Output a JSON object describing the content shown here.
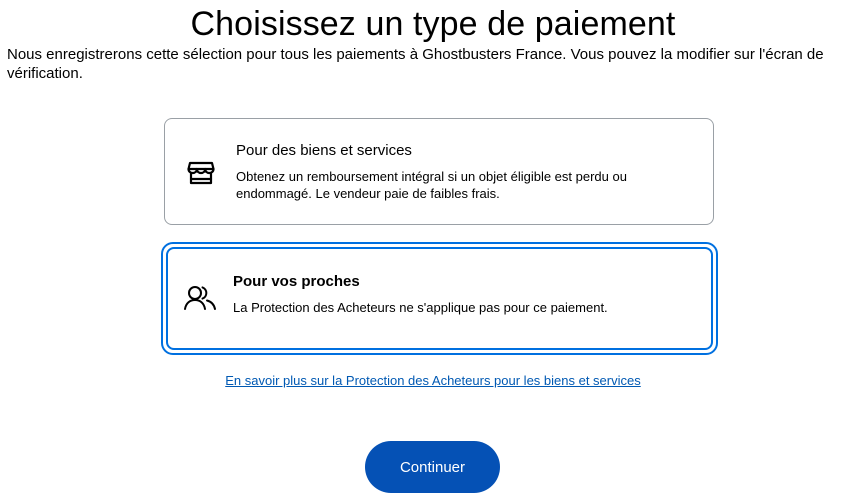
{
  "header": {
    "title": "Choisissez un type de paiement",
    "subtitle": "Nous enregistrerons cette sélection pour tous les paiements à Ghostbusters France. Vous pouvez la modifier sur l'écran de vérification."
  },
  "options": [
    {
      "title": "Pour des biens et services",
      "description": "Obtenez un remboursement intégral si un objet éligible est perdu ou endommagé. Le vendeur paie de faibles frais.",
      "icon": "storefront-icon",
      "selected": false
    },
    {
      "title": "Pour vos proches",
      "description": "La Protection des Acheteurs ne s'applique pas pour ce paiement.",
      "icon": "people-icon",
      "selected": true
    }
  ],
  "links": {
    "learn_more": "En savoir plus sur la Protection des Acheteurs pour les biens et services"
  },
  "actions": {
    "continue_label": "Continuer"
  },
  "colors": {
    "accent": "#0070e0",
    "button": "#0551b5",
    "link": "#0059b3",
    "card_border": "#9aa0a6"
  }
}
